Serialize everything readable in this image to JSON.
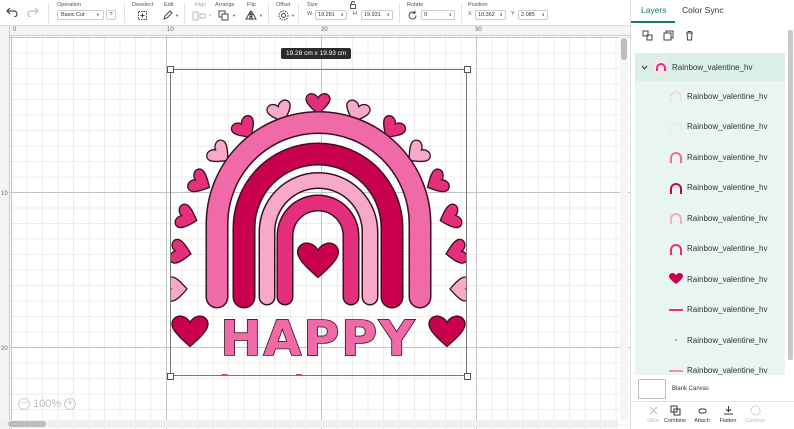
{
  "colors": {
    "accent": "#1c7c5a",
    "pink_light": "#f7a9c9",
    "pink_mid": "#f06aa8",
    "pink_hot": "#e52e7c",
    "pink_deep": "#c9004e",
    "outline": "#3a1020"
  },
  "toolbar": {
    "undo_icon": "undo-icon",
    "redo_icon": "redo-icon",
    "operation": {
      "label": "Operation",
      "value": "Basic Cut",
      "badge": "?"
    },
    "deselect": {
      "label": "Deselect"
    },
    "edit": {
      "label": "Edit"
    },
    "align": {
      "label": "Align"
    },
    "arrange": {
      "label": "Arrange"
    },
    "flip": {
      "label": "Flip"
    },
    "offset": {
      "label": "Offset"
    },
    "size": {
      "label": "Size",
      "w_label": "W",
      "w_value": "19.281",
      "h_label": "H",
      "h_value": "19.931"
    },
    "rotate": {
      "label": "Rotate",
      "value": "0"
    },
    "position": {
      "label": "Position",
      "x_label": "X",
      "x_value": "10.362",
      "y_label": "Y",
      "y_value": "2.085"
    }
  },
  "canvas": {
    "ruler_top": [
      "0",
      "10",
      "20",
      "30"
    ],
    "ruler_left": [
      "10",
      "20"
    ],
    "dimension_badge": "19.28  cm x 19.93  cm",
    "art": {
      "line1": "HAPPY",
      "line2": "Valentine's Day"
    },
    "zoom": {
      "minus": "−",
      "value": "100%",
      "plus": "+"
    }
  },
  "panel": {
    "tabs": [
      "Layers",
      "Color Sync"
    ],
    "group": {
      "name": "Rainbow_valentine_hv"
    },
    "layers": [
      {
        "name": "Rainbow_valentine_hv",
        "thumb": "dotted-arc",
        "color": "#f7a9c9"
      },
      {
        "name": "Rainbow_valentine_hv",
        "thumb": "faint-arc",
        "color": "#e8e8e8"
      },
      {
        "name": "Rainbow_valentine_hv",
        "thumb": "arc",
        "color": "#f06aa8"
      },
      {
        "name": "Rainbow_valentine_hv",
        "thumb": "arc",
        "color": "#c9004e"
      },
      {
        "name": "Rainbow_valentine_hv",
        "thumb": "arc",
        "color": "#f7a9c9"
      },
      {
        "name": "Rainbow_valentine_hv",
        "thumb": "arc",
        "color": "#e52e7c"
      },
      {
        "name": "Rainbow_valentine_hv",
        "thumb": "heart",
        "color": "#c9004e"
      },
      {
        "name": "Rainbow_valentine_hv",
        "thumb": "text",
        "color": "#e52e7c"
      },
      {
        "name": "Rainbow_valentine_hv",
        "thumb": "dot",
        "color": "#999999"
      },
      {
        "name": "Rainbow_valentine_hv",
        "thumb": "line",
        "color": "#e52e7c"
      }
    ],
    "blank_canvas": "Blank Canvas",
    "actions": [
      {
        "label": "Slice",
        "enabled": false
      },
      {
        "label": "Combine",
        "enabled": true
      },
      {
        "label": "Attach",
        "enabled": true
      },
      {
        "label": "Flatten",
        "enabled": true
      },
      {
        "label": "Contour",
        "enabled": false
      }
    ]
  }
}
